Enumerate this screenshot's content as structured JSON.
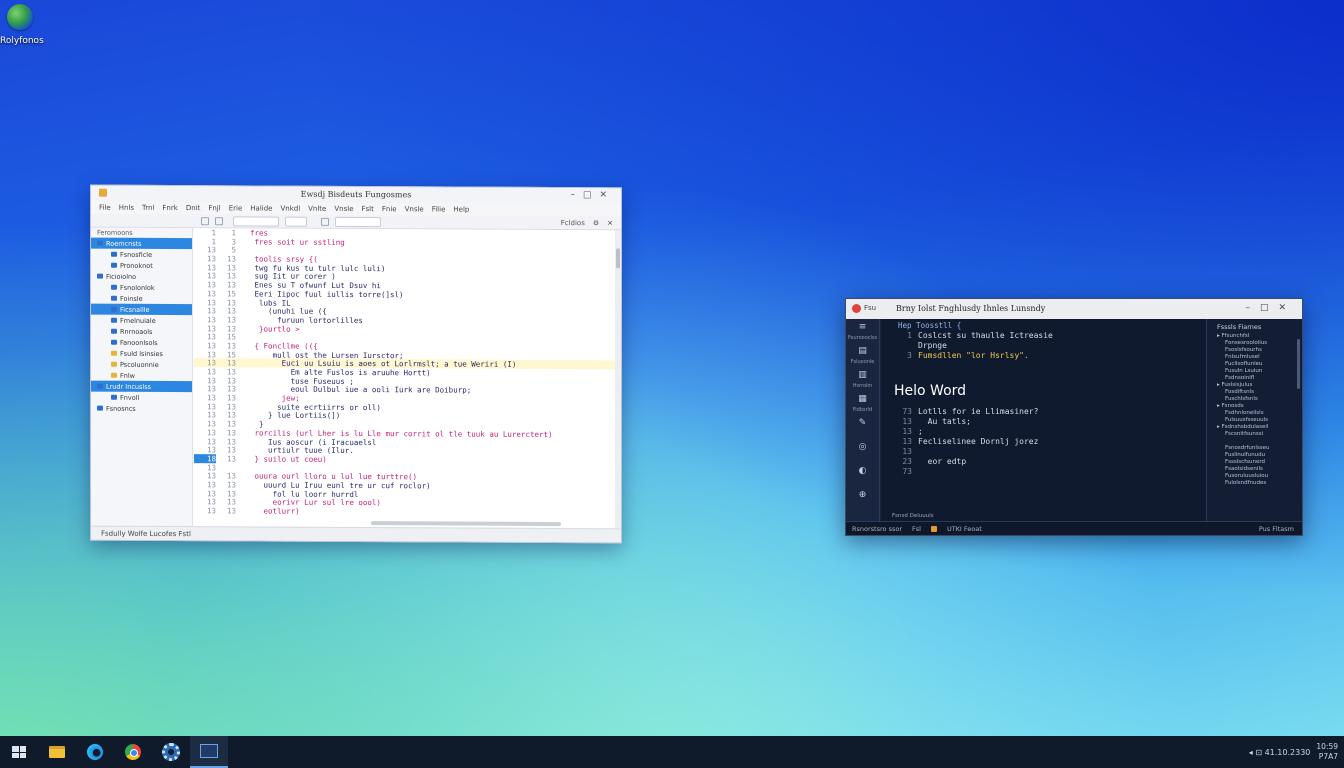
{
  "desktop": {
    "icon_label": "Rolyfonos"
  },
  "left_window": {
    "title": "Ewsdj Bisdeuts Fungosmes",
    "menu": [
      "File",
      "Hnls",
      "Trnl",
      "Fnrk",
      "Dnit",
      "Fnjl",
      "Erie",
      "Halide",
      "Vnkdl",
      "Vnlte",
      "Vnsle",
      "Fslt",
      "Fnie",
      "Vnsle",
      "Filie",
      "Help"
    ],
    "toolbar_right_label": "Fcldios",
    "sidebar_header": "Feromoons",
    "sidebar_items": [
      {
        "label": "Roemcnsts",
        "indent": false,
        "selected": true,
        "yellow": false
      },
      {
        "label": "Fsnosficle",
        "indent": true,
        "selected": false,
        "yellow": false
      },
      {
        "label": "Pronoknot",
        "indent": true,
        "selected": false,
        "yellow": false
      },
      {
        "label": "Ficioiolno",
        "indent": false,
        "selected": false,
        "yellow": false
      },
      {
        "label": "Fsnolonlok",
        "indent": true,
        "selected": false,
        "yellow": false
      },
      {
        "label": "Foinsle",
        "indent": true,
        "selected": false,
        "yellow": false
      },
      {
        "label": "Ficsnallle",
        "indent": true,
        "selected": true,
        "yellow": false
      },
      {
        "label": "Fmelnuiale",
        "indent": true,
        "selected": false,
        "yellow": false
      },
      {
        "label": "Rnrnoaols",
        "indent": true,
        "selected": false,
        "yellow": false
      },
      {
        "label": "Fanoonlsols",
        "indent": true,
        "selected": false,
        "yellow": false
      },
      {
        "label": "Fsuld lsinsies",
        "indent": true,
        "selected": false,
        "yellow": true
      },
      {
        "label": "Pscoluonnie",
        "indent": true,
        "selected": false,
        "yellow": true
      },
      {
        "label": "Fnlw",
        "indent": true,
        "selected": false,
        "yellow": true
      },
      {
        "label": "Lrudr Incuslss",
        "indent": false,
        "selected": true,
        "yellow": false
      },
      {
        "label": "Fnvoll",
        "indent": true,
        "selected": false,
        "yellow": false
      },
      {
        "label": "Fsnosncs",
        "indent": false,
        "selected": false,
        "yellow": false
      }
    ],
    "code_lines": [
      {
        "n1": "1",
        "n2": "1",
        "code": "fres",
        "cls": "kw"
      },
      {
        "n1": "1",
        "n2": "3",
        "code": " fres soit ur sstling",
        "cls": "kw"
      },
      {
        "n1": "13",
        "n2": "5",
        "code": "",
        "cls": "tx"
      },
      {
        "n1": "13",
        "n2": "13",
        "code": " toolis srsy {(",
        "cls": "kw"
      },
      {
        "n1": "13",
        "n2": "13",
        "code": " twg fu kus tu tulr lulc luli)",
        "cls": "tx"
      },
      {
        "n1": "13",
        "n2": "13",
        "code": " sug Iit ur corer )",
        "cls": "tx"
      },
      {
        "n1": "13",
        "n2": "13",
        "code": " Enes su T ofwunf Lut Dsuv hi",
        "cls": "tx"
      },
      {
        "n1": "13",
        "n2": "15",
        "code": " Eeri Iipoc fuul iullis torre(]sl)",
        "cls": "tx"
      },
      {
        "n1": "13",
        "n2": "13",
        "code": "  lubs IL",
        "cls": "tx"
      },
      {
        "n1": "13",
        "n2": "13",
        "code": "    (unuhi lue ({",
        "cls": "tx"
      },
      {
        "n1": "13",
        "n2": "13",
        "code": "      furuun lortorlilles",
        "cls": "tx"
      },
      {
        "n1": "13",
        "n2": "13",
        "code": "  }ourtlo >",
        "cls": "kw"
      },
      {
        "n1": "13",
        "n2": "15",
        "code": "",
        "cls": "tx"
      },
      {
        "n1": "13",
        "n2": "13",
        "code": " { Foncllme (({",
        "cls": "kw"
      },
      {
        "n1": "13",
        "n2": "15",
        "code": "     mull ost the Lursen Iursctor;",
        "cls": "tx"
      },
      {
        "n1": "13",
        "n2": "13",
        "code": "       Euci uu Lsuiu is aoes ot Lorlrmslt; a tue Weriri (I)",
        "cls": "tx",
        "hl": true
      },
      {
        "n1": "13",
        "n2": "13",
        "code": "         Em alte Fuslos is aruuhe Hortt)",
        "cls": "tx"
      },
      {
        "n1": "13",
        "n2": "13",
        "code": "         tuse Fuseuus ;",
        "cls": "tx"
      },
      {
        "n1": "13",
        "n2": "13",
        "code": "         eoul Dulbul iue a ooli Iurk are Doiburp;",
        "cls": "tx"
      },
      {
        "n1": "13",
        "n2": "13",
        "code": "       jew;",
        "cls": "kw"
      },
      {
        "n1": "13",
        "n2": "13",
        "code": "      suite ecrtiirrs or oll)",
        "cls": "tx"
      },
      {
        "n1": "13",
        "n2": "13",
        "code": "    } lue Lortiis(])",
        "cls": "tx"
      },
      {
        "n1": "13",
        "n2": "13",
        "code": "  }",
        "cls": "tx"
      },
      {
        "n1": "13",
        "n2": "13",
        "code": " rorcilis (url Lher is lu Lle mur corrit ol tle tuuk au Lurerctert)",
        "cls": "kw"
      },
      {
        "n1": "13",
        "n2": "13",
        "code": "    Ius aoscur (i Iracuaelsl",
        "cls": "tx"
      },
      {
        "n1": "13",
        "n2": "13",
        "code": "    urtiulr tuue (Ilur.",
        "cls": "tx"
      },
      {
        "n1": "18",
        "n2": "13",
        "code": " } suilo ut coeu)",
        "cls": "kw",
        "cur": true
      },
      {
        "n1": "13",
        "n2": "",
        "code": "",
        "cls": "tx"
      },
      {
        "n1": "13",
        "n2": "13",
        "code": " ouura ourl lloro u lul lue turttre()",
        "cls": "kw"
      },
      {
        "n1": "13",
        "n2": "13",
        "code": "   uuurd Lu Iruu eunl tre ur cuf roclor)",
        "cls": "tx"
      },
      {
        "n1": "13",
        "n2": "13",
        "code": "     fol lu loorr hurrdl",
        "cls": "tx"
      },
      {
        "n1": "13",
        "n2": "13",
        "code": "     eorivr Lur sul lre oool)",
        "cls": "kw"
      },
      {
        "n1": "13",
        "n2": "13",
        "code": "   eotlurr)",
        "cls": "kw"
      }
    ],
    "status_bar": "Fsdully   Wolfe   Lucofes   Fstl"
  },
  "right_window": {
    "app_label": "Fsu",
    "title": "Brny Iolst Fnghlusdy Ihnles Lunsndy",
    "activity_items": [
      {
        "icon": "≡",
        "label": "Feuroooclss"
      },
      {
        "icon": "▤",
        "label": "Fsluoonle"
      },
      {
        "icon": "▥",
        "label": "Hsrrolm"
      },
      {
        "icon": "▦",
        "label": "Fidbsrld"
      },
      {
        "icon": "✎",
        "label": ""
      },
      {
        "icon": "◎",
        "label": ""
      },
      {
        "icon": "◐",
        "label": ""
      },
      {
        "icon": "⊕",
        "label": ""
      }
    ],
    "editor_header": "Hep Toosstll {",
    "lines_top": [
      {
        "n": "1",
        "c": "Coslcst su thaulle Ictreasie",
        "y": false
      },
      {
        "n": "",
        "c": "Drpnge",
        "y": false
      },
      {
        "n": "3",
        "c": "Fumsdllen \"lor Hsrlsy\".",
        "y": true
      },
      {
        "n": "",
        "c": "",
        "y": false
      }
    ],
    "hello_text": "Helo Word",
    "lines_bottom": [
      {
        "n": "73",
        "c": "Lotlls for ie Llimasiner?",
        "y": false
      },
      {
        "n": "13",
        "c": "  Au tatls;",
        "y": false
      },
      {
        "n": "13",
        "c": ";",
        "y": false
      },
      {
        "n": "13",
        "c": "Fecliselinee Dornlj jorez",
        "y": false
      },
      {
        "n": "13",
        "c": "",
        "y": false
      },
      {
        "n": "23",
        "c": "  eor edtp",
        "y": false
      },
      {
        "n": "73",
        "c": "",
        "y": false
      }
    ],
    "outline_header": "Fsssls Fiarnes",
    "outline_items": [
      {
        "t": "▸ Ffsunchfsl",
        "b": true
      },
      {
        "t": "Fonsesrooloilus",
        "b": false
      },
      {
        "t": "Fsoslsfsourhs",
        "b": false
      },
      {
        "t": "Fnlsufmlusel",
        "b": false
      },
      {
        "t": "Fucllsoflunleu",
        "b": false
      },
      {
        "t": "Fusuln Lsuiun",
        "b": false
      },
      {
        "t": "Fsdnsoinifl",
        "b": false
      },
      {
        "t": "▸ Fuslsisjulus",
        "b": true
      },
      {
        "t": "Fosdiftsnls",
        "b": false
      },
      {
        "t": "Fuschlsfsnls",
        "b": false
      },
      {
        "t": "▸ Fsnosds",
        "b": true
      },
      {
        "t": "Fsdhnloneilsls",
        "b": false
      },
      {
        "t": "Fulsuusfsseuuls",
        "b": false
      },
      {
        "t": "▸ Fsdnshsbdulaseil",
        "b": true
      },
      {
        "t": "Fscsnitfsunssi",
        "b": false
      },
      {
        "t": "",
        "b": false
      },
      {
        "t": "Fsnosdrfunlsseu",
        "b": false
      },
      {
        "t": "Fuslinulfunudu",
        "b": false
      },
      {
        "t": "Fssslscfsunerd",
        "b": false
      },
      {
        "t": "Fsaolsidsenils",
        "b": false
      },
      {
        "t": "Fusoruluusluiou",
        "b": false
      },
      {
        "t": "Fulolsndfnudes",
        "b": false
      }
    ],
    "panel_tab": "Fsnsd Deluuuls",
    "status_left": "Rsnorstsro ssor",
    "status_mid": "Fsl",
    "status_enc": "UTKI Feoat",
    "status_right": "Pus Fltasm"
  },
  "taskbar": {
    "items": [
      {
        "name": "start-button",
        "icon": "windows-icon"
      },
      {
        "name": "taskbar-file-explorer",
        "icon": "folder-icon"
      },
      {
        "name": "taskbar-edge",
        "icon": "edge-icon"
      },
      {
        "name": "taskbar-chrome",
        "icon": "chrome-icon"
      },
      {
        "name": "taskbar-settings",
        "icon": "gear-icon"
      },
      {
        "name": "taskbar-terminal",
        "icon": "terminal-icon"
      }
    ],
    "clock_time": "10:59",
    "clock_date": "P7A7",
    "tray_text": "◂ ⊡ 41.10.2330"
  }
}
